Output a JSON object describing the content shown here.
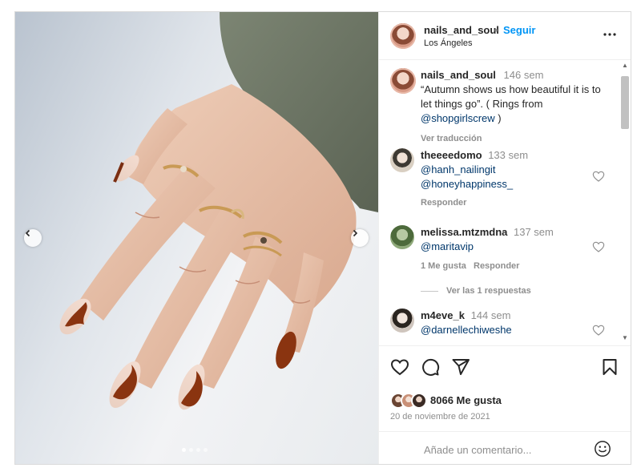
{
  "post": {
    "username": "nails_and_soul",
    "separator": "•",
    "follow_label": "Seguir",
    "location": "Los Ángeles",
    "more_icon": "more-horizontal-icon"
  },
  "caption": {
    "username": "nails_and_soul",
    "time": "146 sem",
    "text_before": "“Autumn shows us how beautiful it is to let things go”. ( Rings from ",
    "mention": "@shopgirlscrew",
    "text_after": " )",
    "translate_label": "Ver traducción"
  },
  "comments": [
    {
      "username": "theeeedomo",
      "time": "133 sem",
      "mentions": [
        "@hanh_nailingit",
        "@honeyhappiness_"
      ],
      "reply_label": "Responder"
    },
    {
      "username": "melissa.mtzmdna",
      "time": "137 sem",
      "mentions": [
        "@maritavip"
      ],
      "likes_label": "1 Me gusta",
      "reply_label": "Responder",
      "view_replies_label": "Ver las 1 respuestas"
    },
    {
      "username": "m4eve_k",
      "time": "144 sem",
      "mentions": [
        "@darnellechiweshe"
      ]
    }
  ],
  "actions": {
    "like_icon": "heart-icon",
    "comment_icon": "comment-icon",
    "share_icon": "send-icon",
    "save_icon": "bookmark-icon"
  },
  "likes": {
    "count_label": "8066 Me gusta"
  },
  "date": "20 de noviembre de 2021",
  "add_comment": {
    "placeholder": "Añade un comentario...",
    "emoji_icon": "emoji-icon"
  },
  "carousel": {
    "total": 4,
    "active": 1
  },
  "colors": {
    "link_blue": "#0095f6",
    "mention": "#00376b",
    "muted": "#8e8e8e",
    "text": "#262626"
  }
}
